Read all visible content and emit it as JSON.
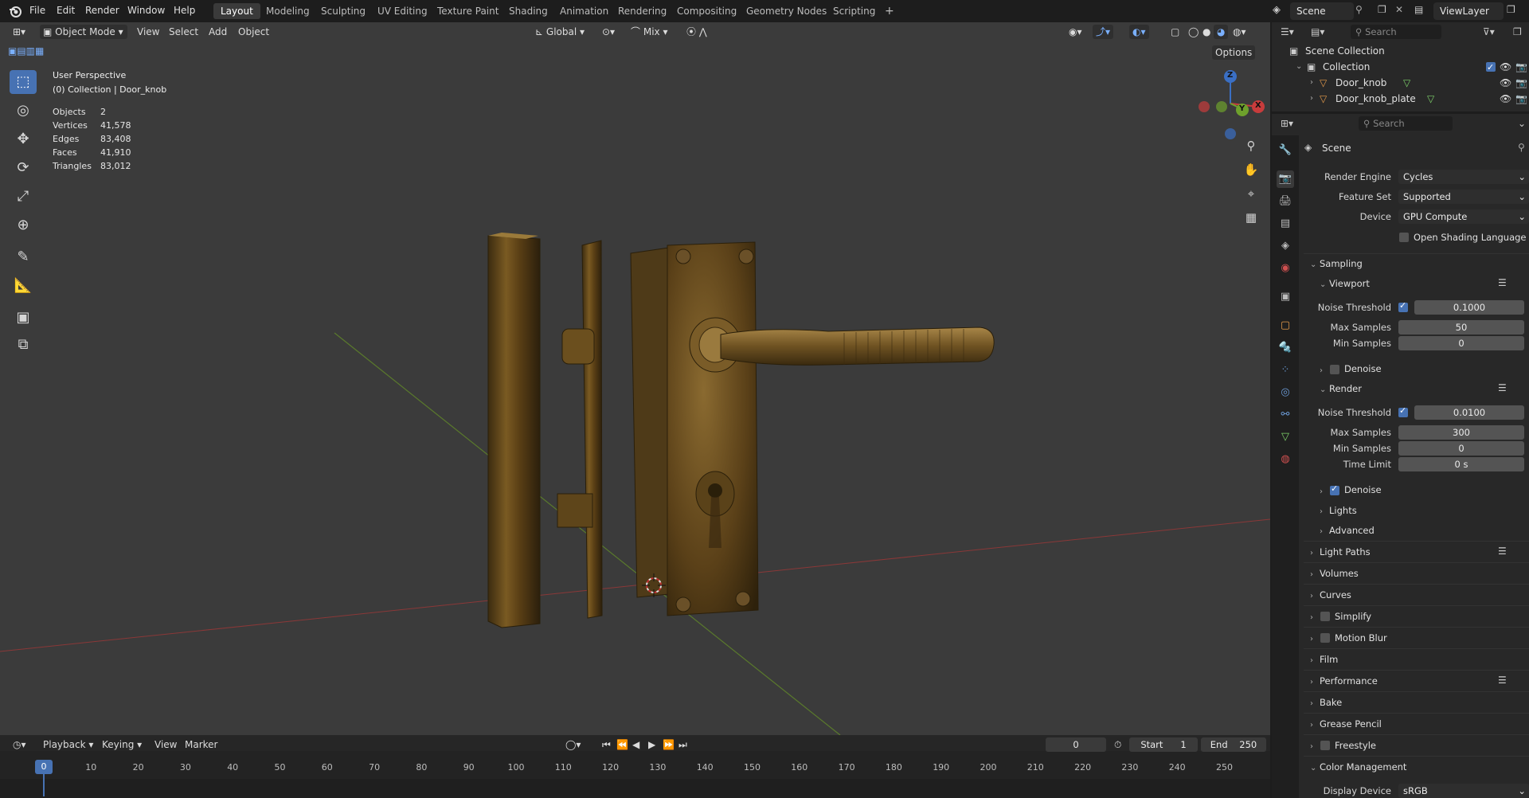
{
  "topbar": {
    "menus": [
      "File",
      "Edit",
      "Render",
      "Window",
      "Help"
    ],
    "workspaces": [
      "Layout",
      "Modeling",
      "Sculpting",
      "UV Editing",
      "Texture Paint",
      "Shading",
      "Animation",
      "Rendering",
      "Compositing",
      "Geometry Nodes",
      "Scripting"
    ],
    "active_workspace": "Layout",
    "add_label": "+",
    "scene_name": "Scene",
    "view_layer": "ViewLayer"
  },
  "viewport_header": {
    "mode": "Object Mode",
    "menus": [
      "View",
      "Select",
      "Add",
      "Object"
    ],
    "orientation": "Global",
    "snap_mode": "Mix",
    "options_label": "Options"
  },
  "viewport_overlay": {
    "view_name": "User Perspective",
    "collection_line": "(0) Collection | Door_knob",
    "stats": [
      {
        "key": "Objects",
        "value": "2"
      },
      {
        "key": "Vertices",
        "value": "41,578"
      },
      {
        "key": "Edges",
        "value": "83,408"
      },
      {
        "key": "Faces",
        "value": "41,910"
      },
      {
        "key": "Triangles",
        "value": "83,012"
      }
    ]
  },
  "gizmo": {
    "z": "Z",
    "y": "Y",
    "x": "X"
  },
  "timeline": {
    "menus": [
      "Playback",
      "Keying",
      "View",
      "Marker"
    ],
    "current_frame": "0",
    "start_label": "Start",
    "start": "1",
    "end_label": "End",
    "end": "250",
    "ticks": [
      "0",
      "10",
      "20",
      "30",
      "40",
      "50",
      "60",
      "70",
      "80",
      "90",
      "100",
      "110",
      "120",
      "130",
      "140",
      "150",
      "160",
      "170",
      "180",
      "190",
      "200",
      "210",
      "220",
      "230",
      "240",
      "250"
    ],
    "playhead": "0"
  },
  "outliner": {
    "search_placeholder": "Search",
    "root": "Scene Collection",
    "collection": "Collection",
    "objects": [
      "Door_knob",
      "Door_knob_plate"
    ]
  },
  "properties": {
    "search_placeholder": "Search",
    "context": "Scene",
    "render_engine_label": "Render Engine",
    "render_engine": "Cycles",
    "feature_set_label": "Feature Set",
    "feature_set": "Supported",
    "device_label": "Device",
    "device": "GPU Compute",
    "osl_label": "Open Shading Language",
    "sampling": "Sampling",
    "viewport": {
      "title": "Viewport",
      "noise_threshold_label": "Noise Threshold",
      "noise_threshold": "0.1000",
      "max_samples_label": "Max Samples",
      "max_samples": "50",
      "min_samples_label": "Min Samples",
      "min_samples": "0",
      "denoise_label": "Denoise"
    },
    "render": {
      "title": "Render",
      "noise_threshold_label": "Noise Threshold",
      "noise_threshold": "0.0100",
      "max_samples_label": "Max Samples",
      "max_samples": "300",
      "min_samples_label": "Min Samples",
      "min_samples": "0",
      "time_limit_label": "Time Limit",
      "time_limit": "0 s",
      "denoise_label": "Denoise"
    },
    "sub_sections": [
      "Lights",
      "Advanced"
    ],
    "sections": [
      "Light Paths",
      "Volumes",
      "Curves",
      "Simplify",
      "Motion Blur",
      "Film",
      "Performance",
      "Bake",
      "Grease Pencil",
      "Freestyle",
      "Color Management"
    ],
    "display_device_label": "Display Device",
    "display_device": "sRGB"
  }
}
